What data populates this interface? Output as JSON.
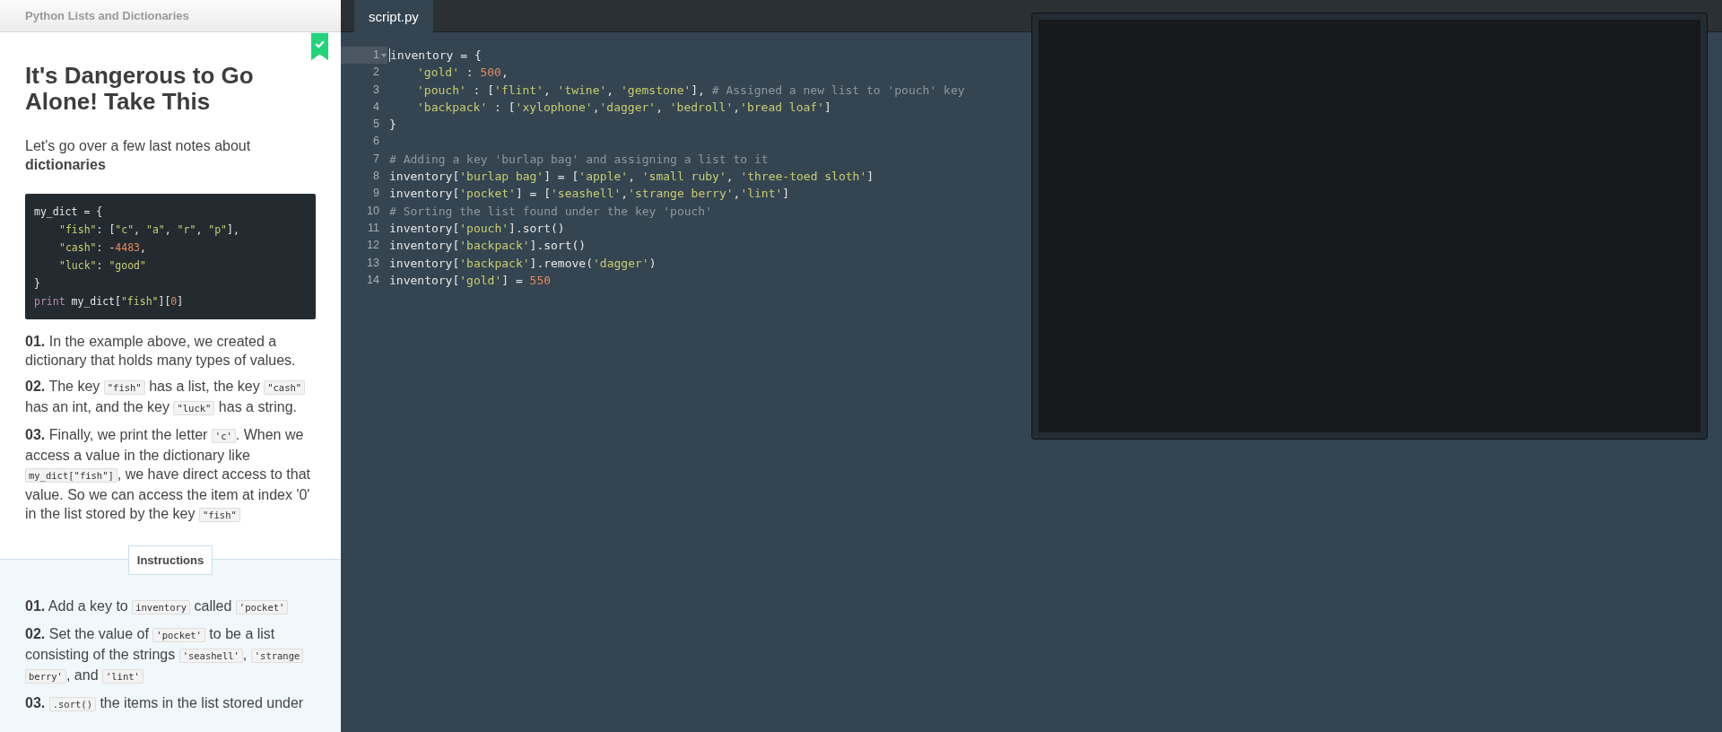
{
  "header": {
    "title": "Python Lists and Dictionaries"
  },
  "lesson": {
    "completed": true,
    "title": "It's Dangerous to Go Alone! Take This",
    "intro": "Let's go over a few last notes about **dictionaries**",
    "example_code": [
      {
        "indent": false,
        "tokens": [
          {
            "plain": "my_dict = {"
          }
        ]
      },
      {
        "indent": true,
        "tokens": [
          {
            "string": "\"fish\""
          },
          {
            "plain": ": ["
          },
          {
            "string": "\"c\""
          },
          {
            "plain": ", "
          },
          {
            "string": "\"a\""
          },
          {
            "plain": ", "
          },
          {
            "string": "\"r\""
          },
          {
            "plain": ", "
          },
          {
            "string": "\"p\""
          },
          {
            "plain": "],"
          }
        ]
      },
      {
        "indent": true,
        "tokens": [
          {
            "string": "\"cash\""
          },
          {
            "plain": ": -"
          },
          {
            "number": "4483"
          },
          {
            "plain": ","
          }
        ]
      },
      {
        "indent": true,
        "tokens": [
          {
            "string": "\"luck\""
          },
          {
            "plain": ": "
          },
          {
            "string": "\"good\""
          }
        ]
      },
      {
        "indent": false,
        "tokens": [
          {
            "plain": "}"
          }
        ]
      },
      {
        "indent": false,
        "tokens": [
          {
            "keyword": "print"
          },
          {
            "plain": " my_dict["
          },
          {
            "string": "\"fish\""
          },
          {
            "plain": "]["
          },
          {
            "number": "0"
          },
          {
            "plain": "]"
          }
        ]
      }
    ],
    "notes": [
      {
        "number": "01.",
        "segments": [
          {
            "text": "In the example above, we created a dictionary that holds many types of values."
          }
        ]
      },
      {
        "number": "02.",
        "segments": [
          {
            "text": "The key "
          },
          {
            "code": "\"fish\""
          },
          {
            "text": " has a list, the key "
          },
          {
            "code": "\"cash\""
          },
          {
            "text": " has an int, and the key "
          },
          {
            "code": "\"luck\""
          },
          {
            "text": " has a string."
          }
        ]
      },
      {
        "number": "03.",
        "segments": [
          {
            "text": "Finally, we print the letter "
          },
          {
            "code": "'c'"
          },
          {
            "text": ". When we access a value in the dictionary like "
          },
          {
            "code": "my_dict[\"fish\"]"
          },
          {
            "text": ", we have direct access to that value. So we can access the item at index '0' in the list stored by the key "
          },
          {
            "code": "\"fish\""
          }
        ]
      }
    ]
  },
  "instructions": {
    "label": "Instructions",
    "steps": [
      {
        "number": "01.",
        "segments": [
          {
            "text": "Add a key to "
          },
          {
            "code": "inventory"
          },
          {
            "text": " called "
          },
          {
            "code": "'pocket'"
          }
        ]
      },
      {
        "number": "02.",
        "segments": [
          {
            "text": "Set the value of "
          },
          {
            "code": "'pocket'"
          },
          {
            "text": " to be a list consisting of the strings "
          },
          {
            "code": "'seashell'"
          },
          {
            "text": ", "
          },
          {
            "code": "'strange berry'"
          },
          {
            "text": ", and "
          },
          {
            "code": "'lint'"
          }
        ]
      },
      {
        "number": "03.",
        "segments": [
          {
            "code": ".sort()"
          },
          {
            "text": " the items in the list stored under"
          }
        ]
      }
    ]
  },
  "editor": {
    "tabs": [
      {
        "label": "script.py",
        "selected": true
      }
    ],
    "lines": [
      {
        "number": "1",
        "active": true,
        "foldable": true,
        "indent": false,
        "tokens": [
          {
            "plain": "inventory = {"
          }
        ]
      },
      {
        "number": "2",
        "active": false,
        "foldable": false,
        "indent": true,
        "tokens": [
          {
            "string": "'gold'"
          },
          {
            "plain": " : "
          },
          {
            "number": "500"
          },
          {
            "plain": ","
          }
        ]
      },
      {
        "number": "3",
        "active": false,
        "foldable": false,
        "indent": true,
        "tokens": [
          {
            "string": "'pouch'"
          },
          {
            "plain": " : ["
          },
          {
            "string": "'flint'"
          },
          {
            "plain": ", "
          },
          {
            "string": "'twine'"
          },
          {
            "plain": ", "
          },
          {
            "string": "'gemstone'"
          },
          {
            "plain": "], "
          },
          {
            "comment": "# Assigned a new list to 'pouch' key"
          }
        ]
      },
      {
        "number": "4",
        "active": false,
        "foldable": false,
        "indent": true,
        "tokens": [
          {
            "string": "'backpack'"
          },
          {
            "plain": " : ["
          },
          {
            "string": "'xylophone'"
          },
          {
            "plain": ","
          },
          {
            "string": "'dagger'"
          },
          {
            "plain": ", "
          },
          {
            "string": "'bedroll'"
          },
          {
            "plain": ","
          },
          {
            "string": "'bread loaf'"
          },
          {
            "plain": "]"
          }
        ]
      },
      {
        "number": "5",
        "active": false,
        "foldable": false,
        "indent": false,
        "tokens": [
          {
            "plain": "}"
          }
        ]
      },
      {
        "number": "6",
        "active": false,
        "foldable": false,
        "indent": false
      },
      {
        "number": "7",
        "active": false,
        "foldable": false,
        "indent": false,
        "tokens": [
          {
            "comment": "# Adding a key 'burlap bag' and assigning a list to it"
          }
        ]
      },
      {
        "number": "8",
        "active": false,
        "foldable": false,
        "indent": false,
        "tokens": [
          {
            "plain": "inventory["
          },
          {
            "string": "'burlap bag'"
          },
          {
            "plain": "] = ["
          },
          {
            "string": "'apple'"
          },
          {
            "plain": ", "
          },
          {
            "string": "'small ruby'"
          },
          {
            "plain": ", "
          },
          {
            "string": "'three-toed sloth'"
          },
          {
            "plain": "]"
          }
        ]
      },
      {
        "number": "9",
        "active": false,
        "foldable": false,
        "indent": false,
        "tokens": [
          {
            "plain": "inventory["
          },
          {
            "string": "'pocket'"
          },
          {
            "plain": "] = ["
          },
          {
            "string": "'seashell'"
          },
          {
            "plain": ","
          },
          {
            "string": "'strange berry'"
          },
          {
            "plain": ","
          },
          {
            "string": "'lint'"
          },
          {
            "plain": "]"
          }
        ]
      },
      {
        "number": "10",
        "active": false,
        "foldable": false,
        "indent": false,
        "tokens": [
          {
            "comment": "# Sorting the list found under the key 'pouch'"
          }
        ]
      },
      {
        "number": "11",
        "active": false,
        "foldable": false,
        "indent": false,
        "tokens": [
          {
            "plain": "inventory["
          },
          {
            "string": "'pouch'"
          },
          {
            "plain": "].sort()"
          }
        ]
      },
      {
        "number": "12",
        "active": false,
        "foldable": false,
        "indent": false,
        "tokens": [
          {
            "plain": "inventory["
          },
          {
            "string": "'backpack'"
          },
          {
            "plain": "].sort()"
          }
        ]
      },
      {
        "number": "13",
        "active": false,
        "foldable": false,
        "indent": false,
        "tokens": [
          {
            "plain": "inventory["
          },
          {
            "string": "'backpack'"
          },
          {
            "plain": "].remove("
          },
          {
            "string": "'dagger'"
          },
          {
            "plain": ")"
          }
        ]
      },
      {
        "number": "14",
        "active": false,
        "foldable": false,
        "indent": false,
        "tokens": [
          {
            "plain": "inventory["
          },
          {
            "string": "'gold'"
          },
          {
            "plain": "] = "
          },
          {
            "number": "550"
          }
        ]
      }
    ]
  }
}
